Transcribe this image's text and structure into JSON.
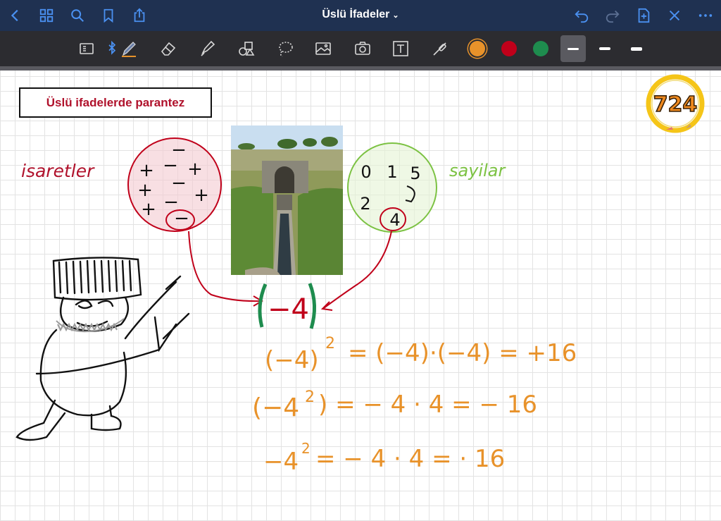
{
  "app": {
    "document_title": "Üslü İfadeler"
  },
  "heading": {
    "text": "Üslü ifadelerde parantez"
  },
  "badge": {
    "number": "724"
  },
  "colors": {
    "orange": "#e8922a",
    "red": "#c0001a",
    "green": "#1e8c4e",
    "accent": "#4a90f0",
    "label_red": "#b0122c",
    "label_green": "#7cc243"
  },
  "labels": {
    "signs": "isaretler",
    "numbers": "sayilar"
  },
  "signs_circle": {
    "symbols": [
      "−",
      "+",
      "−",
      "+",
      "+",
      "−",
      "+",
      "+",
      "−",
      "−"
    ]
  },
  "numbers_circle": {
    "digits": [
      "0",
      "1",
      "5",
      "2",
      "4"
    ]
  },
  "center_expression": {
    "text": "−4"
  },
  "equations": [
    {
      "text": "(−4)",
      "exponent": "2",
      "rest": "= (−4)·(−4) = +16"
    },
    {
      "text": "(−4",
      "exponent": "2",
      "rest": ") = − 4 · 4  = − 16"
    },
    {
      "text": "−4",
      "exponent": "2",
      "rest": "=   − 4 · 4  = · 16"
    }
  ]
}
